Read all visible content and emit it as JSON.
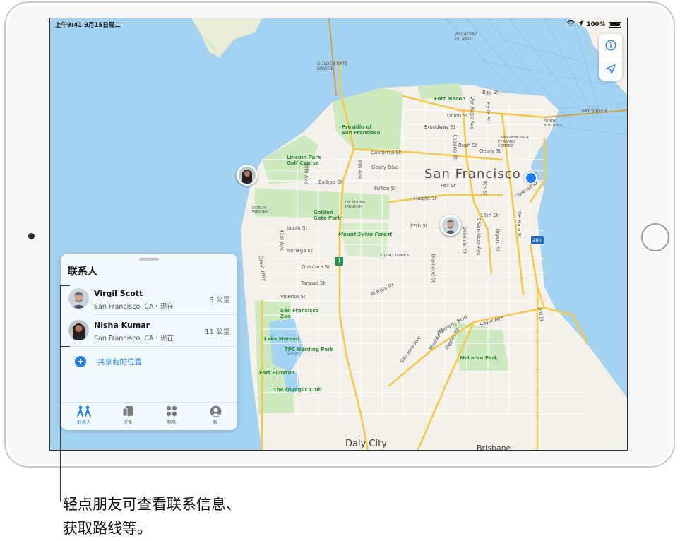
{
  "status_bar": {
    "time": "上午9:41  9月15日周二",
    "battery": "100%"
  },
  "map": {
    "city": "San Francisco",
    "city_south": "Daly City",
    "brisbane": "Brisbane",
    "labels": {
      "alcatraz": "ALCATRAZ\nISLAND",
      "golden_gate_bridge": "GOLDEN GATE\nBRIDGE",
      "fort_mason": "Fort Mason",
      "presidio": "Presidio of\nSan Francisco",
      "lincoln_park": "Lincoln Park\nGolf Course",
      "golden_gate_park": "Golden\nGate Park",
      "de_young": "DE YOUNG\nMUSEUM",
      "dutch_windmill": "DUTCH\nWINDMILL",
      "mount_sutro": "Mount Sutro Forest",
      "sutro_tower": "SUTRO TOWER",
      "sf_zoo": "San Francisco\nZoo",
      "lake_merced": "Lake Merced",
      "tpc_harding": "TPC Harding Park",
      "fort_funston": "Fort Funston",
      "olympic_club": "The Olympic Club",
      "mclaren": "McLaren Park",
      "bay_bridge": "BAY BRIDGE",
      "ferry_building": "FERRY\nBUILDING",
      "transamerica": "TRANSAMERICA\nPYRAMID\nCENTER",
      "highway_1": "1",
      "highway_280": "280",
      "streets": [
        "Bay St",
        "Union St",
        "Broadway St",
        "California St",
        "Geary Blvd",
        "Balboa St",
        "Fulton St",
        "Bush St",
        "Geary St",
        "Fell St",
        "Haight St",
        "17th St",
        "16th St",
        "Judah St",
        "Noriega St",
        "Quintara St",
        "Taraval St",
        "Vicente St",
        "Portola Dr",
        "Silver Ave",
        "Alemany Blvd",
        "Mission St",
        "Naples St",
        "San Jose Ave",
        "Diamond St",
        "Valencia St",
        "S Van Ness Ave",
        "Bryant St",
        "De Haro St",
        "Great Hwy",
        "41st Ave",
        "30th Ave",
        "8th Ave",
        "Laguna St",
        "Hyde St",
        "Van Ness Ave",
        "9th St",
        "3rd St",
        "Townsend",
        "Lake"
      ]
    }
  },
  "contacts_panel": {
    "title": "联系人",
    "contacts": [
      {
        "name": "Virgil Scott",
        "location": "San Francisco, CA・现在",
        "distance": "3 公里"
      },
      {
        "name": "Nisha Kumar",
        "location": "San Francisco, CA・现在",
        "distance": "11 公里"
      }
    ],
    "share_label": "共享我的位置",
    "tabs": [
      {
        "label": "联系人",
        "icon": "people-icon"
      },
      {
        "label": "设备",
        "icon": "devices-icon"
      },
      {
        "label": "物品",
        "icon": "items-icon"
      },
      {
        "label": "我",
        "icon": "me-icon"
      }
    ]
  },
  "caption": {
    "line1": "轻点朋友可查看联系信息、",
    "line2": "获取路线等。"
  },
  "colors": {
    "water": "#a4d2f1",
    "land": "#f3f1e9",
    "park": "#cde9c0",
    "road": "#f4c94a",
    "accent": "#1e7cf5"
  }
}
